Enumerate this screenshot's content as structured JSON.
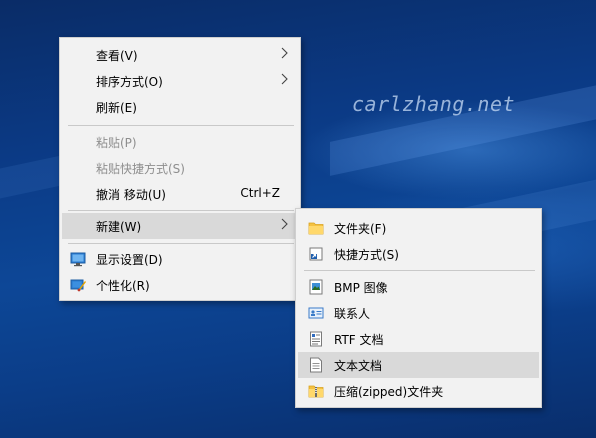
{
  "watermark": "carlzhang.net",
  "context_menu": {
    "items": [
      {
        "label": "查看(V)",
        "arrow": ">"
      },
      {
        "label": "排序方式(O)",
        "arrow": ">"
      },
      {
        "label": "刷新(E)"
      },
      {
        "label": "粘贴(P)",
        "disabled": true
      },
      {
        "label": "粘贴快捷方式(S)",
        "disabled": true
      },
      {
        "label": "撤消 移动(U)",
        "shortcut": "Ctrl+Z"
      },
      {
        "label": "新建(W)",
        "arrow": ">",
        "highlighted": true
      },
      {
        "label": "显示设置(D)",
        "icon": "display-settings-icon"
      },
      {
        "label": "个性化(R)",
        "icon": "personalize-icon"
      }
    ]
  },
  "new_submenu": {
    "items": [
      {
        "label": "文件夹(F)",
        "icon": "folder-icon"
      },
      {
        "label": "快捷方式(S)",
        "icon": "shortcut-icon"
      },
      {
        "label": "BMP 图像",
        "icon": "bmp-image-icon"
      },
      {
        "label": "联系人",
        "icon": "contact-card-icon"
      },
      {
        "label": "RTF 文档",
        "icon": "rtf-document-icon"
      },
      {
        "label": "文本文档",
        "icon": "text-document-icon",
        "highlighted": true
      },
      {
        "label": "压缩(zipped)文件夹",
        "icon": "zip-folder-icon"
      }
    ]
  },
  "colors": {
    "menu_bg": "#f2f2f2",
    "highlight": "#d9d9d9",
    "disabled_text": "#8e8e8e",
    "desktop_blue": "#0b3a85"
  }
}
